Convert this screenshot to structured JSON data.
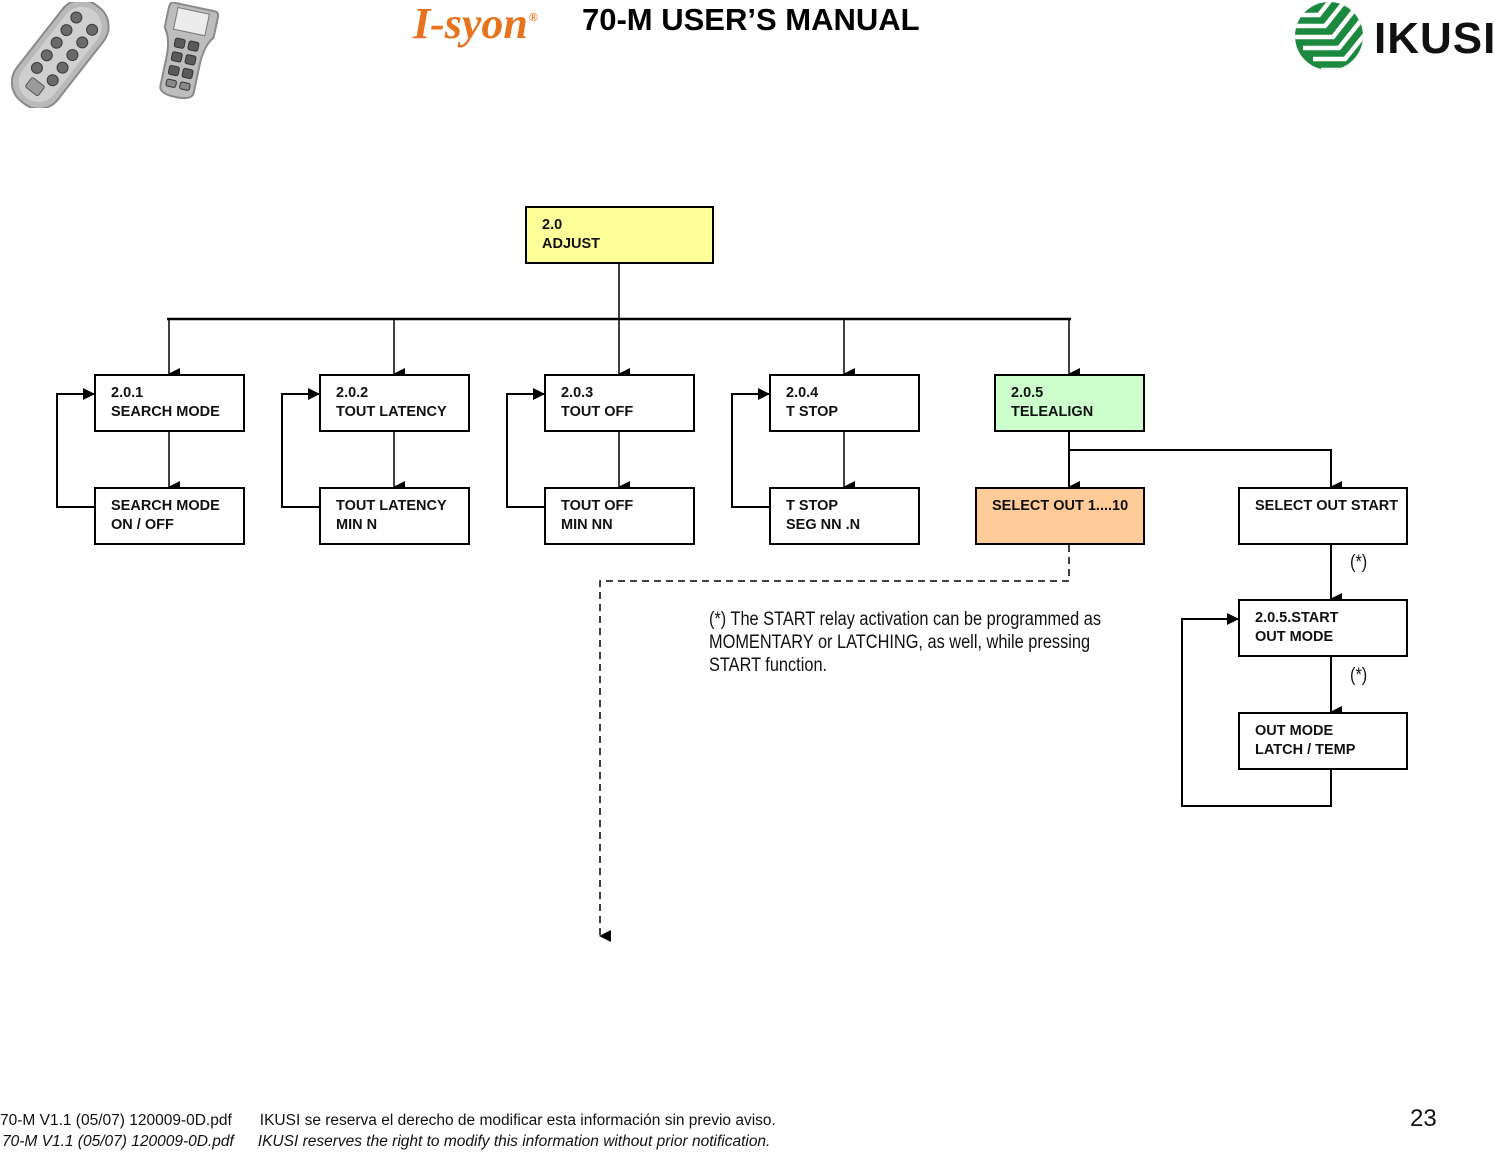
{
  "header": {
    "brand": "I-syon",
    "brand_mark": "®",
    "title": "70-M USER’S MANUAL",
    "company_logo": "IKUSI",
    "device_images": [
      "remote-control-10-button",
      "remote-control-with-display"
    ]
  },
  "diagram": {
    "root": {
      "id": "2.0",
      "lines": [
        "2.0",
        "ADJUST"
      ],
      "color": "#ffff99"
    },
    "branches": [
      {
        "id": "2.0.1",
        "lines": [
          "2.0.1",
          "SEARCH MODE"
        ],
        "child": {
          "lines": [
            "SEARCH MODE",
            "ON / OFF"
          ]
        }
      },
      {
        "id": "2.0.2",
        "lines": [
          "2.0.2",
          "TOUT LATENCY"
        ],
        "child": {
          "lines": [
            "TOUT LATENCY",
            "MIN N"
          ]
        }
      },
      {
        "id": "2.0.3",
        "lines": [
          "2.0.3",
          "TOUT OFF"
        ],
        "child": {
          "lines": [
            "TOUT OFF",
            "MIN NN"
          ]
        }
      },
      {
        "id": "2.0.4",
        "lines": [
          "2.0.4",
          "T STOP"
        ],
        "child": {
          "lines": [
            "T STOP",
            "SEG NN .N"
          ]
        }
      },
      {
        "id": "2.0.5",
        "lines": [
          "2.0.5",
          "TELEALIGN"
        ],
        "color": "#ccffcc"
      }
    ],
    "telealign_children": {
      "select_out": {
        "lines": [
          "SELECT OUT  1....10"
        ],
        "color": "#ffcc99"
      },
      "select_out_start": {
        "lines": [
          "SELECT OUT START"
        ]
      },
      "start_out_mode": {
        "lines": [
          "2.0.5.START",
          "OUT MODE"
        ]
      },
      "out_mode_value": {
        "lines": [
          "OUT MODE",
          "LATCH / TEMP"
        ]
      }
    },
    "asterisk_label": "(*)",
    "note_lines": [
      "(*) The START relay activation can be programmed as",
      "MOMENTARY or LATCHING, as well, while pressing",
      "START function."
    ]
  },
  "footer": {
    "line1_file": "70-M V1.1 (05/07) 120009-0D.pdf",
    "line1_text": "IKUSI se reserva el derecho de modificar esta información sin previo aviso.",
    "line2_file": "70-M V1.1 (05/07) 120009-0D.pdf",
    "line2_text": "IKUSI reserves the right to modify this information without prior notification.",
    "page_number": "23"
  }
}
